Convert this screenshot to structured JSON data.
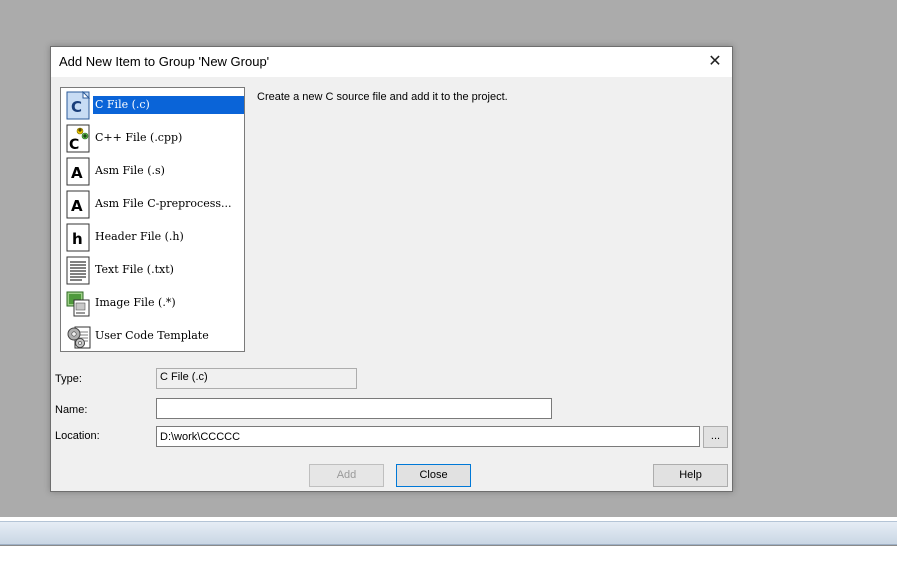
{
  "dialog": {
    "title": "Add New Item to Group 'New Group'",
    "close_glyph": "✕"
  },
  "file_types": [
    {
      "label": "C File (.c)",
      "icon": "c-file-icon",
      "selected": true
    },
    {
      "label": "C++ File (.cpp)",
      "icon": "cpp-file-icon",
      "selected": false
    },
    {
      "label": "Asm File (.s)",
      "icon": "asm-file-icon",
      "selected": false
    },
    {
      "label": "Asm File C-preprocess...",
      "icon": "asm-preprocess-file-icon",
      "selected": false
    },
    {
      "label": "Header File (.h)",
      "icon": "header-file-icon",
      "selected": false
    },
    {
      "label": "Text File (.txt)",
      "icon": "text-file-icon",
      "selected": false
    },
    {
      "label": "Image File (.*)",
      "icon": "image-file-icon",
      "selected": false
    },
    {
      "label": "User Code Template",
      "icon": "user-code-template-icon",
      "selected": false
    }
  ],
  "description": "Create a new C source file and add it to the project.",
  "form": {
    "type_label": "Type:",
    "type_value": "C File (.c)",
    "name_label": "Name:",
    "name_value": "",
    "location_label": "Location:",
    "location_value": "D:\\work\\CCCCC",
    "browse_label": "..."
  },
  "buttons": {
    "add": "Add",
    "close": "Close",
    "help": "Help"
  },
  "colors": {
    "selection": "#0a64d8",
    "background": "#ababab",
    "dialog": "#f0f0f0"
  }
}
